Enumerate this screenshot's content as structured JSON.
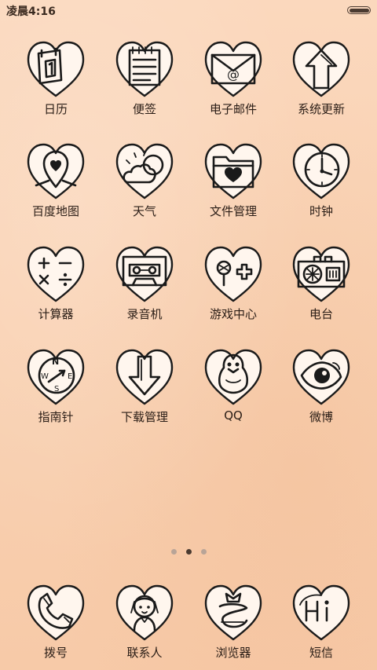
{
  "status_bar": {
    "time": "凌晨4:16"
  },
  "apps": [
    {
      "label": "日历",
      "icon": "calendar-icon"
    },
    {
      "label": "便签",
      "icon": "notepad-icon"
    },
    {
      "label": "电子邮件",
      "icon": "email-icon"
    },
    {
      "label": "系统更新",
      "icon": "update-arrow-icon"
    },
    {
      "label": "百度地图",
      "icon": "map-pin-icon"
    },
    {
      "label": "天气",
      "icon": "weather-icon"
    },
    {
      "label": "文件管理",
      "icon": "folder-icon"
    },
    {
      "label": "时钟",
      "icon": "clock-icon"
    },
    {
      "label": "计算器",
      "icon": "calculator-icon"
    },
    {
      "label": "录音机",
      "icon": "cassette-icon"
    },
    {
      "label": "游戏中心",
      "icon": "gamepad-icon"
    },
    {
      "label": "电台",
      "icon": "radio-icon"
    },
    {
      "label": "指南针",
      "icon": "compass-icon"
    },
    {
      "label": "下载管理",
      "icon": "download-icon"
    },
    {
      "label": "QQ",
      "icon": "penguin-icon"
    },
    {
      "label": "微博",
      "icon": "weibo-eye-icon"
    }
  ],
  "page_indicator": {
    "pages": 3,
    "current": 2
  },
  "dock": [
    {
      "label": "拨号",
      "icon": "phone-icon"
    },
    {
      "label": "联系人",
      "icon": "contact-icon"
    },
    {
      "label": "浏览器",
      "icon": "browser-icon"
    },
    {
      "label": "短信",
      "icon": "sms-hi-icon"
    }
  ],
  "colors": {
    "background": "#f9d1b2",
    "ink": "#1a1a1a",
    "label": "#2a1d16"
  }
}
